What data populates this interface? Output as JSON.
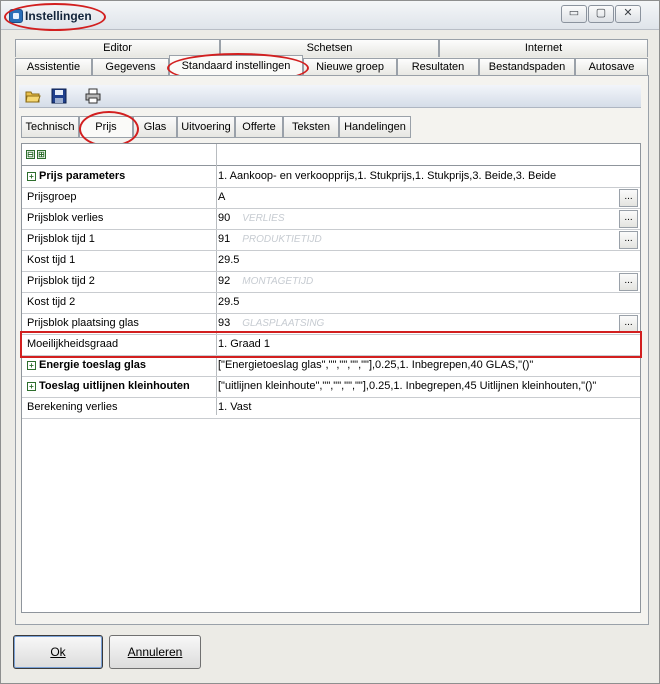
{
  "window": {
    "title": "Instellingen",
    "controls": {
      "minimize": "▭",
      "maximize": "▢",
      "close": "✕"
    }
  },
  "tabs_row1": [
    "Editor",
    "Schetsen",
    "Internet"
  ],
  "tabs_row2": [
    "Assistentie",
    "Gegevens",
    "Standaard instellingen",
    "Nieuwe groep",
    "Resultaten",
    "Bestandspaden",
    "Autosave"
  ],
  "toolbar": {
    "icons": [
      "open-folder-icon",
      "save-icon",
      "print-icon"
    ]
  },
  "subtabs": [
    "Technisch",
    "Prijs",
    "Glas",
    "Uitvoering",
    "Offerte",
    "Teksten",
    "Handelingen"
  ],
  "grid": {
    "expand_all": "⊟",
    "collapse_all": "⊞",
    "rows": [
      {
        "name": "Prijs parameters",
        "value": "1. Aankoop- en verkoopprijs,1. Stukprijs,1. Stukprijs,3. Beide,3. Beide",
        "hint": "",
        "bold": true,
        "expand": true,
        "button": false
      },
      {
        "name": "Prijsgroep",
        "value": "A",
        "hint": "",
        "bold": false,
        "expand": false,
        "button": true
      },
      {
        "name": "Prijsblok verlies",
        "value": "90",
        "hint": "VERLIES",
        "bold": false,
        "expand": false,
        "button": true
      },
      {
        "name": "Prijsblok tijd 1",
        "value": "91",
        "hint": "PRODUKTIETIJD",
        "bold": false,
        "expand": false,
        "button": true
      },
      {
        "name": "Kost tijd 1",
        "value": "29.5",
        "hint": "",
        "bold": false,
        "expand": false,
        "button": false
      },
      {
        "name": "Prijsblok tijd 2",
        "value": "92",
        "hint": "MONTAGETIJD",
        "bold": false,
        "expand": false,
        "button": true
      },
      {
        "name": "Kost tijd 2",
        "value": "29.5",
        "hint": "",
        "bold": false,
        "expand": false,
        "button": false
      },
      {
        "name": "Prijsblok plaatsing glas",
        "value": "93",
        "hint": "GLASPLAATSING",
        "bold": false,
        "expand": false,
        "button": true
      },
      {
        "name": "Moeilijkheidsgraad",
        "value": "1. Graad 1",
        "hint": "",
        "bold": false,
        "expand": false,
        "button": false
      },
      {
        "name": "Energie toeslag glas",
        "value": "[\"Energietoeslag glas\",\"\",\"\",\"\",\"\"],0.25,1. Inbegrepen,40 GLAS,\"()\"",
        "hint": "",
        "bold": true,
        "expand": true,
        "button": false
      },
      {
        "name": "Toeslag uitlijnen kleinhouten",
        "value": "[\"uitlijnen kleinhoute\",\"\",\"\",\"\",\"\"],0.25,1. Inbegrepen,45 Uitlijnen kleinhouten,\"()\"",
        "hint": "",
        "bold": true,
        "expand": true,
        "button": false
      },
      {
        "name": "Berekening verlies",
        "value": "1. Vast",
        "hint": "",
        "bold": false,
        "expand": false,
        "button": false
      }
    ]
  },
  "buttons": {
    "ok": "Ok",
    "cancel": "Annuleren"
  }
}
